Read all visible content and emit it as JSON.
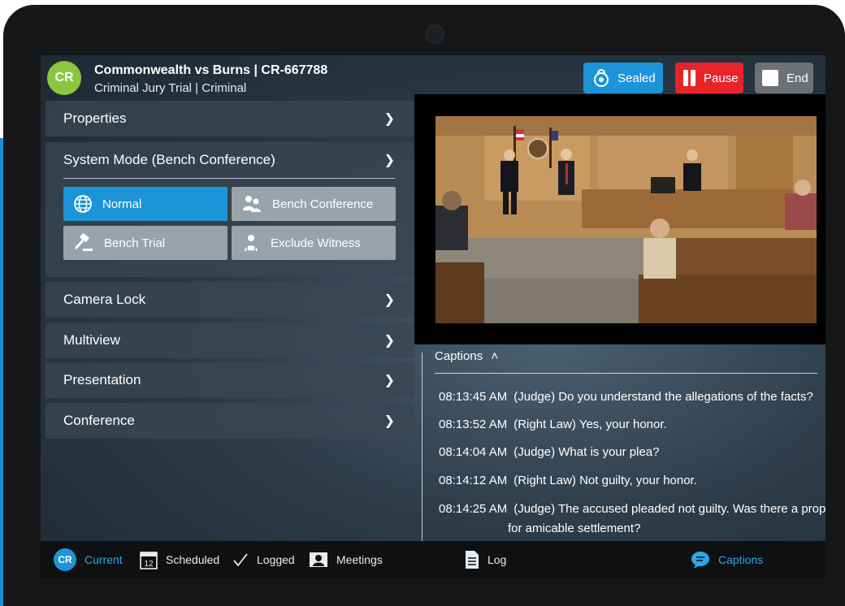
{
  "case": {
    "initials": "CR",
    "title": "Commonwealth vs Burns | CR-667788",
    "subtitle": "Criminal Jury Trial | Criminal"
  },
  "header_buttons": {
    "sealed": "Sealed",
    "pause": "Pause",
    "end": "End"
  },
  "panel": {
    "properties": "Properties",
    "system_mode": "System Mode (Bench Conference)",
    "modes": [
      {
        "label": "Normal",
        "icon": "globe-icon",
        "active": true
      },
      {
        "label": "Bench Conference",
        "icon": "bench-conference-icon",
        "active": false
      },
      {
        "label": "Bench Trial",
        "icon": "gavel-icon",
        "active": false
      },
      {
        "label": "Exclude Witness",
        "icon": "exclude-witness-icon",
        "active": false
      }
    ],
    "camera_lock": "Camera Lock",
    "multiview": "Multiview",
    "presentation": "Presentation",
    "conference": "Conference"
  },
  "captions": {
    "header": "Captions",
    "lines": [
      {
        "time": "08:13:45 AM",
        "text": "(Judge) Do you understand the allegations of the facts?"
      },
      {
        "time": "08:13:52 AM",
        "text": "(Right Law) Yes, your honor."
      },
      {
        "time": "08:14:04 AM",
        "text": "(Judge) What is your plea?"
      },
      {
        "time": "08:14:12 AM",
        "text": "(Right Law) Not guilty, your honor."
      },
      {
        "time": "08:14:25 AM",
        "text": "(Judge) The accused pleaded not guilty.  Was there a proposal",
        "continuation": "for amicable settlement?"
      }
    ]
  },
  "bottom_nav": {
    "current": "Current",
    "current_initials": "CR",
    "scheduled": "Scheduled",
    "scheduled_day": "12",
    "logged": "Logged",
    "meetings": "Meetings",
    "log": "Log",
    "captions": "Captions"
  },
  "colors": {
    "accent_blue": "#1d94d8",
    "pause_red": "#e8242a",
    "avatar_green": "#8cc63f"
  }
}
